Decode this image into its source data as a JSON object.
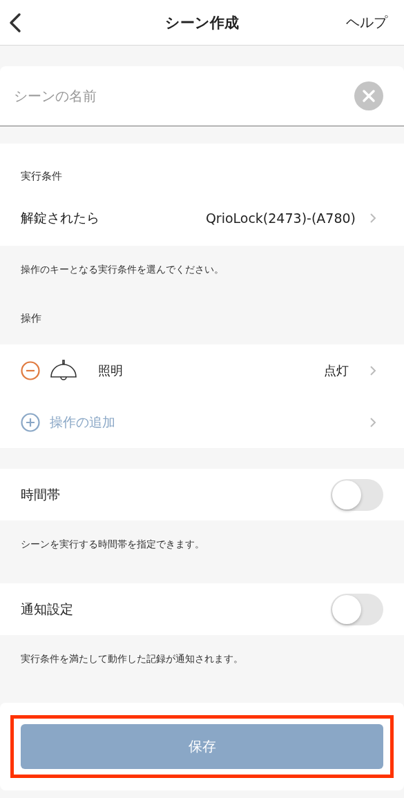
{
  "nav_bar": {
    "title": "シーン作成",
    "help": "ヘルプ"
  },
  "name_field": {
    "placeholder": "シーンの名前"
  },
  "condition": {
    "section_label": "実行条件",
    "row": {
      "label": "解錠されたら",
      "value": "QrioLock(2473)-(A780)"
    },
    "note": "操作のキーとなる実行条件を選んでください。"
  },
  "actions": {
    "section_label": "操作",
    "items": [
      {
        "kind": "device",
        "name": "照明",
        "state": "点灯"
      },
      {
        "kind": "add",
        "name": "操作の追加"
      }
    ]
  },
  "toggles": [
    {
      "label": "時間帯",
      "on": false,
      "note": "シーンを実行する時間帯を指定できます。"
    },
    {
      "label": "通知設定",
      "on": false,
      "note": "実行条件を満たして動作した記録が通知されます。"
    }
  ],
  "save_button": {
    "label": "保存",
    "highlighted": true
  }
}
